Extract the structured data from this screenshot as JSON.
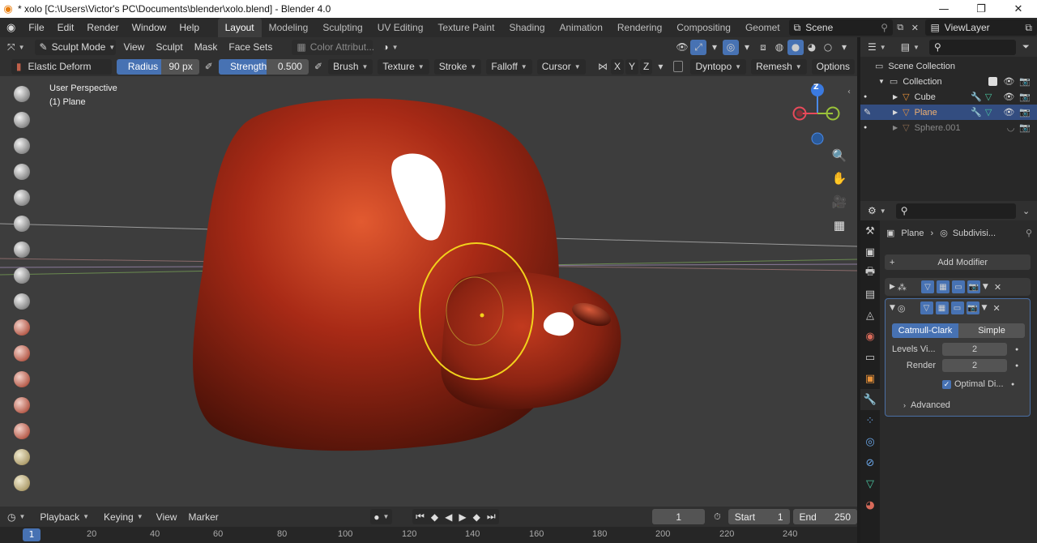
{
  "window": {
    "title": "* xolo [C:\\Users\\Victor's PC\\Documents\\blender\\xolo.blend] - Blender 4.0",
    "min": "—",
    "max": "❐",
    "close": "✕"
  },
  "menu": {
    "items": [
      "File",
      "Edit",
      "Render",
      "Window",
      "Help"
    ]
  },
  "workspaces": {
    "tabs": [
      "Layout",
      "Modeling",
      "Sculpting",
      "UV Editing",
      "Texture Paint",
      "Shading",
      "Animation",
      "Rendering",
      "Compositing",
      "Geomet"
    ],
    "active": "Layout"
  },
  "scene": {
    "name": "Scene",
    "view_layer": "ViewLayer"
  },
  "viewport_header": {
    "mode": "Sculpt Mode",
    "menus": [
      "View",
      "Sculpt",
      "Mask",
      "Face Sets"
    ],
    "color_attr": "Color Attribut..."
  },
  "tool_settings": {
    "brush": "Elastic Deform",
    "radius_label": "Radius",
    "radius_value": "90 px",
    "strength_label": "Strength",
    "strength_value": "0.500",
    "dropdowns": [
      "Brush",
      "Texture",
      "Stroke",
      "Falloff",
      "Cursor"
    ],
    "axes": [
      "X",
      "Y",
      "Z"
    ],
    "dyntopo": "Dyntopo",
    "remesh": "Remesh",
    "options": "Options"
  },
  "viewport": {
    "perspective": "User Perspective",
    "object": "(1) Plane",
    "gizmo_z": "Z"
  },
  "timeline": {
    "menus": [
      "Playback",
      "Keying",
      "View",
      "Marker"
    ],
    "current_frame": "1",
    "start_label": "Start",
    "start_value": "1",
    "end_label": "End",
    "end_value": "250",
    "ruler": [
      "1",
      "20",
      "40",
      "60",
      "80",
      "100",
      "120",
      "140",
      "160",
      "180",
      "200",
      "220",
      "240"
    ]
  },
  "outliner": {
    "root": "Scene Collection",
    "collection": "Collection",
    "items": [
      {
        "name": "Cube",
        "selected": false,
        "dim": false
      },
      {
        "name": "Plane",
        "selected": true,
        "dim": false
      },
      {
        "name": "Sphere.001",
        "selected": false,
        "dim": true
      }
    ]
  },
  "properties": {
    "breadcrumb_object": "Plane",
    "breadcrumb_modifier": "Subdivisi...",
    "add_modifier": "Add Modifier",
    "subdiv_types": [
      "Catmull-Clark",
      "Simple"
    ],
    "levels_label": "Levels Vi...",
    "levels_value": "2",
    "render_label": "Render",
    "render_value": "2",
    "optimal_label": "Optimal Di...",
    "advanced_label": "Advanced"
  },
  "colors": {
    "accent": "#4772b3",
    "selection": "#334d80",
    "brush_ring": "#f2d21c",
    "mesh": "#b3341c"
  }
}
